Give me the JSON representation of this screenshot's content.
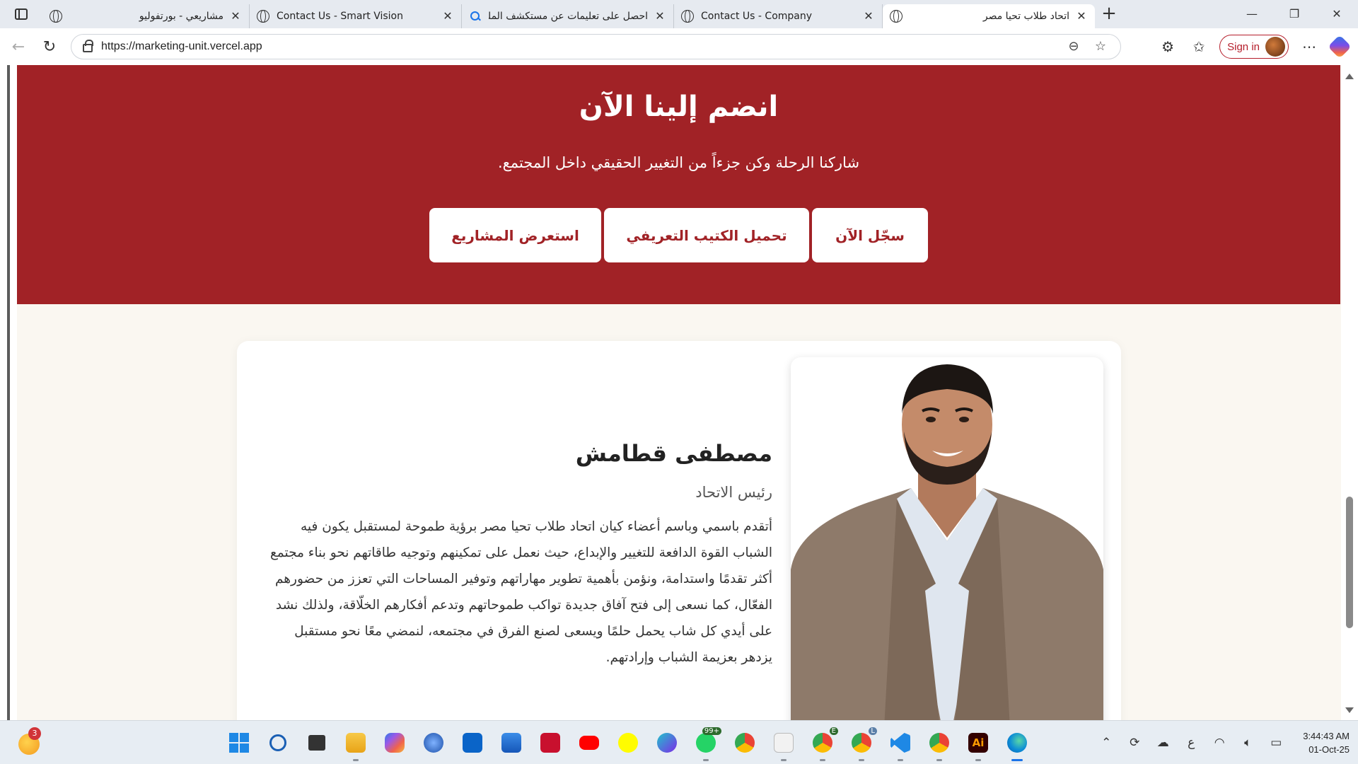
{
  "browser": {
    "tabs": [
      {
        "title": "مشاريعي - بورتفوليو",
        "icon": "globe-icon",
        "rtl": true
      },
      {
        "title": "Contact Us - Smart Vision",
        "icon": "globe-icon",
        "rtl": false
      },
      {
        "title": "احصل على تعليمات عن مستكشف الملفات في",
        "icon": "search-icon",
        "rtl": true
      },
      {
        "title": "Contact Us - Company",
        "icon": "globe-icon",
        "rtl": false
      },
      {
        "title": "اتحاد طلاب تحيا مصر",
        "icon": "globe-icon",
        "rtl": true,
        "active": true
      }
    ],
    "url": "https://marketing-unit.vercel.app",
    "sign_in_label": "Sign in"
  },
  "join": {
    "title": "انضم إلينا الآن",
    "subtitle": "شاركنا الرحلة وكن جزءاً من التغيير الحقيقي داخل المجتمع.",
    "buttons": {
      "register": "سجّل الآن",
      "download_brochure": "تحميل الكتيب التعريفي",
      "projects": "استعرض المشاريع"
    },
    "accent_color": "#a12226"
  },
  "leader": {
    "name": "مصطفى قطامش",
    "role": "رئيس الاتحاد",
    "bio": "أتقدم باسمي وباسم أعضاء كيان اتحاد طلاب تحيا مصر برؤية طموحة لمستقبل يكون فيه الشباب القوة الدافعة للتغيير والإبداع، حيث نعمل على تمكينهم وتوجيه طاقاتهم نحو بناء مجتمع أكثر تقدمًا واستدامة، ونؤمن بأهمية تطوير مهاراتهم وتوفير المساحات التي تعزز من حضورهم الفعّال، كما نسعى إلى فتح آفاق جديدة تواكب طموحاتهم وتدعم أفكارهم الخلّاقة، ولذلك نشد على أيدي كل شاب يحمل حلمًا ويسعى لصنع الفرق في مجتمعه، لنمضي معًا نحو مستقبل يزدهر بعزيمة الشباب وإرادتهم."
  },
  "taskbar": {
    "weather_badge": "3",
    "whatsapp_badge": "99+",
    "chrome_profile_1": "E",
    "chrome_profile_2": "L",
    "language": "ع",
    "time": "3:44:43 AM",
    "date": "01-Oct-25"
  }
}
